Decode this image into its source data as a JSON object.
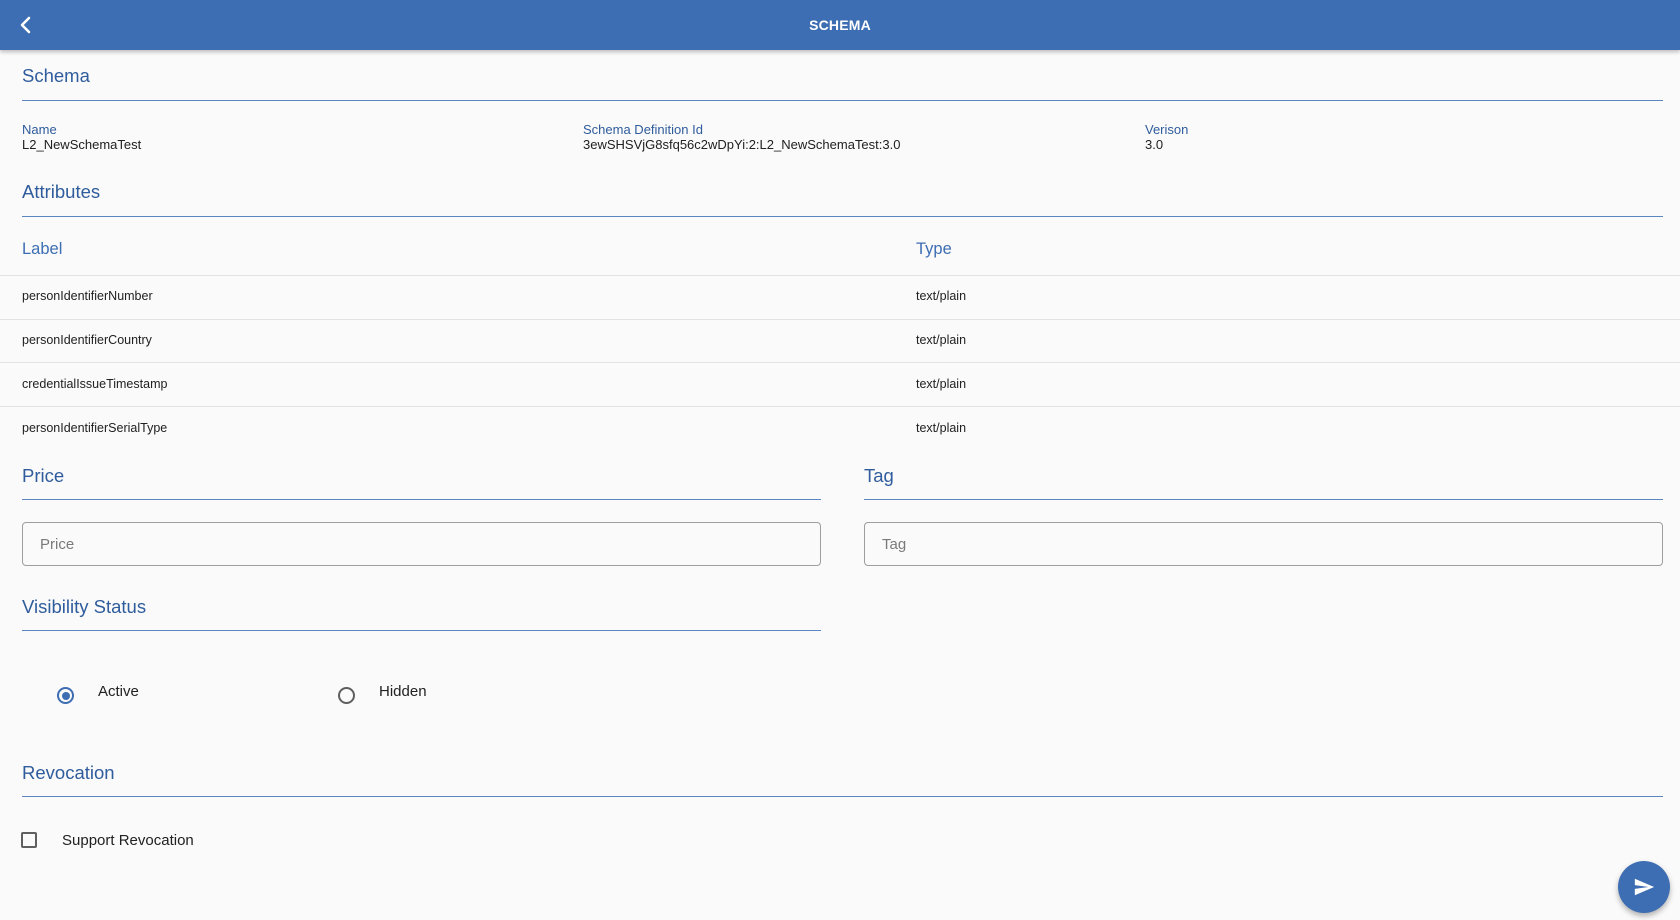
{
  "appbar": {
    "title": "SCHEMA",
    "back_icon": "chevron-left-icon"
  },
  "schema_section": {
    "title": "Schema",
    "name_label": "Name",
    "name_value": "L2_NewSchemaTest",
    "definition_label": "Schema Definition Id",
    "definition_value": "3ewSHSVjG8sfq56c2wDpYi:2:L2_NewSchemaTest:3.0",
    "version_label": "Verison",
    "version_value": "3.0"
  },
  "attributes_section": {
    "title": "Attributes",
    "columns": [
      "Label",
      "Type"
    ],
    "rows": [
      [
        "personIdentifierNumber",
        "text/plain"
      ],
      [
        "personIdentifierCountry",
        "text/plain"
      ],
      [
        "credentialIssueTimestamp",
        "text/plain"
      ],
      [
        "personIdentifierSerialType",
        "text/plain"
      ]
    ]
  },
  "price_section": {
    "title": "Price",
    "placeholder": "Price",
    "value": ""
  },
  "tag_section": {
    "title": "Tag",
    "placeholder": "Tag",
    "value": ""
  },
  "visibility_section": {
    "title": "Visibility Status",
    "options": [
      {
        "label": "Active",
        "selected": true
      },
      {
        "label": "Hidden",
        "selected": false
      }
    ]
  },
  "revocation_section": {
    "title": "Revocation",
    "checkbox_label": "Support Revocation",
    "checked": false
  },
  "fab": {
    "icon": "send-icon"
  },
  "colors": {
    "primary": "#3d6db2",
    "background": "#fafafa",
    "heading": "#2f5c9c"
  }
}
